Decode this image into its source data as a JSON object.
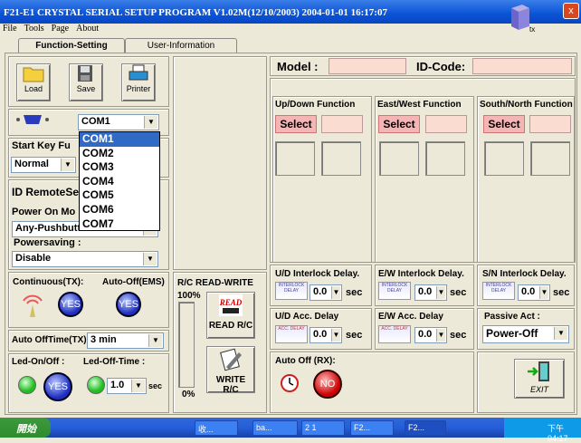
{
  "window": {
    "title": "F21-E1 CRYSTAL SERIAL SETUP PROGRAM V1.02M(12/10/2003) 2004-01-01 16:17:07",
    "close": "x"
  },
  "menu": [
    "File",
    "Tools",
    "Page",
    "About"
  ],
  "tray_cube_label": "tx",
  "tabs": [
    "Function-Setting",
    "User-Information"
  ],
  "toolbar": {
    "load": "Load",
    "save": "Save",
    "printer": "Printer"
  },
  "port": {
    "value": "COM1",
    "options": [
      "COM1",
      "COM2",
      "COM3",
      "COM4",
      "COM5",
      "COM6",
      "COM7"
    ]
  },
  "start_key": {
    "label": "Start Key Fu",
    "value": "Normal"
  },
  "id_remote": {
    "label": "ID RemoteSe"
  },
  "power_on": {
    "label": "Power On Mo",
    "value": "Any-Pushbutt"
  },
  "powersaving": {
    "label": "Powersaving  :",
    "value": "Disable"
  },
  "continuous": {
    "label": "Continuous(TX):",
    "state": "YES"
  },
  "auto_off_ems": {
    "label": "Auto-Off(EMS)",
    "state": "YES"
  },
  "auto_off_time": {
    "label": "Auto OffTime(TX):",
    "value": "3  min"
  },
  "led_onoff": {
    "label": "Led-On/Off  :",
    "state": "YES"
  },
  "led_off_time": {
    "label": "Led-Off-Time :",
    "value": "1.0",
    "unit": "sec"
  },
  "rc": {
    "title": "R/C READ-WRITE",
    "top": "100%",
    "bottom": "0%",
    "read": "READ R/C",
    "write": "WRITE R/C",
    "read_icon": "READ",
    "progress": 0
  },
  "model": {
    "label": "Model :",
    "id_label": "ID-Code:"
  },
  "functions": [
    {
      "title": "Up/Down Function",
      "select": "Select"
    },
    {
      "title": "East/West Function",
      "select": "Select"
    },
    {
      "title": "South/North Function",
      "select": "Select"
    }
  ],
  "delays": [
    {
      "title": "U/D Interlock Delay.",
      "value": "0.0",
      "unit": "sec",
      "icon": "INTERLOCK DELAY"
    },
    {
      "title": "E/W Interlock Delay.",
      "value": "0.0",
      "unit": "sec",
      "icon": "INTERLOCK DELAY"
    },
    {
      "title": "S/N Interlock Delay.",
      "value": "0.0",
      "unit": "sec",
      "icon": "INTERLOCK DELAY"
    },
    {
      "title": "U/D Acc. Delay",
      "value": "0.0",
      "unit": "sec",
      "icon": "ACC. DELAY"
    },
    {
      "title": "E/W Acc. Delay",
      "value": "0.0",
      "unit": "sec",
      "icon": "ACC. DELAY"
    }
  ],
  "passive": {
    "label": "Passive Act :",
    "value": "Power-Off"
  },
  "auto_off_rx": {
    "label": "Auto Off (RX):",
    "state": "NO"
  },
  "exit": "EXIT",
  "taskbar": {
    "start": "開始",
    "items": [
      "收...",
      "ba...",
      "2 1",
      "F2...",
      "F2..."
    ],
    "clock": "下午 04:17"
  }
}
